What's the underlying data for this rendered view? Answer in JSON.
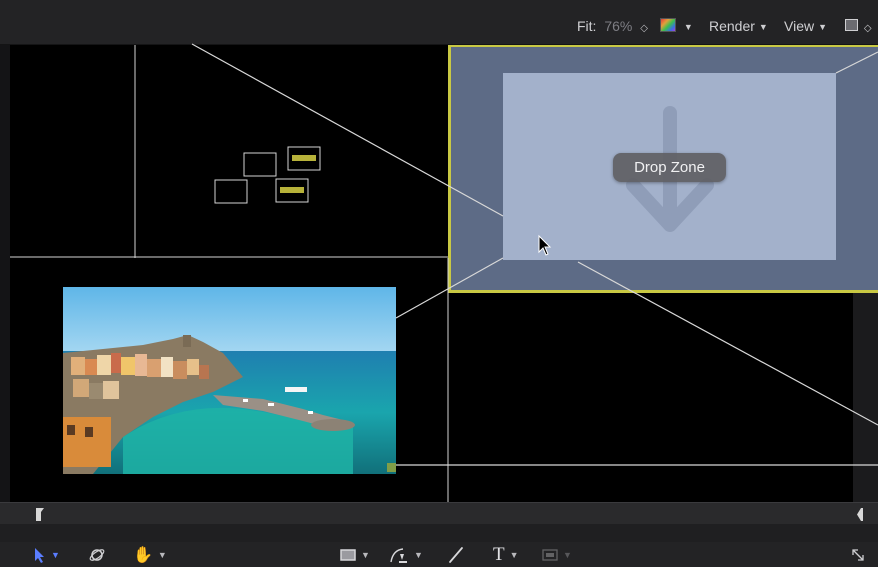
{
  "toolbar": {
    "fit_label": "Fit:",
    "fit_value": "76%",
    "render_label": "Render",
    "view_label": "View"
  },
  "canvas": {
    "drop_zone_label": "Drop Zone"
  },
  "photo": {
    "subject": "coastal village photo"
  },
  "icons": {
    "fit_stepper": "stepper-icon",
    "color_channels": "color-channels-icon",
    "layout_toggle": "layout-icon",
    "select_tool": "arrow-select-icon",
    "orbit_tool": "3d-transform-icon",
    "pan_tool": "hand-icon",
    "shape_tool": "rectangle-icon",
    "bezier_tool": "pen-icon",
    "paint_tool": "paint-stroke-icon",
    "text_tool": "text-icon",
    "mask_tool": "mask-icon",
    "fullscreen": "expand-icon"
  },
  "colors": {
    "selection_outline": "#c9c943",
    "drop_zone_outer": "#5d6b86",
    "drop_zone_inner": "#a3b1cb",
    "active_tool": "#5a7dff"
  }
}
